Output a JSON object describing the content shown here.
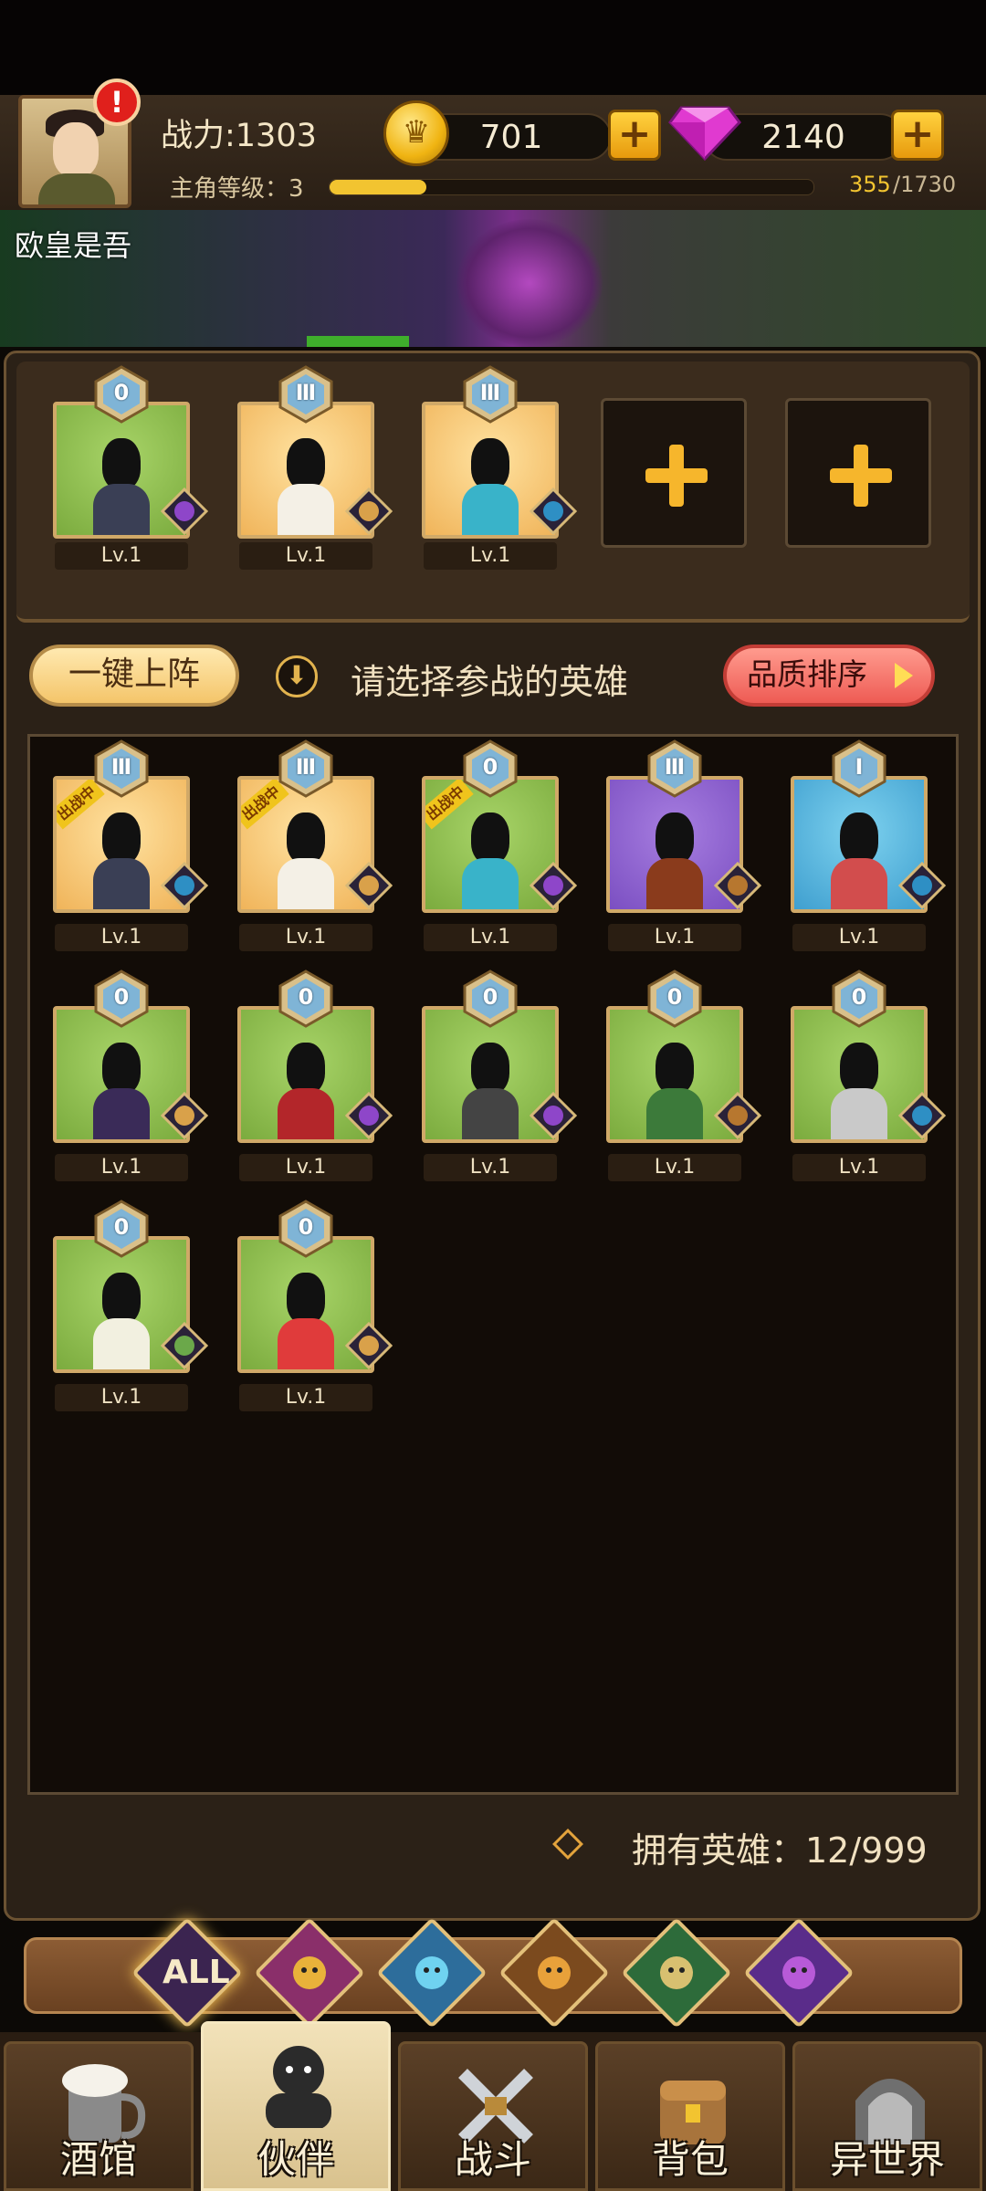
{
  "player": {
    "name": "欧皇是吾",
    "power_label": "战力:1303",
    "level_label": "主角等级：3",
    "xp_current": "355",
    "xp_max": "/1730",
    "xp_fraction": 0.2,
    "alert_icon": "exclamation-icon"
  },
  "resources": {
    "gold": "701",
    "gems": "2140"
  },
  "team": {
    "slots": [
      {
        "rank": "0",
        "level": "Lv.1",
        "card_color": "green",
        "faction": "demon"
      },
      {
        "rank": "Ⅲ",
        "level": "Lv.1",
        "card_color": "gold",
        "faction": "human"
      },
      {
        "rank": "Ⅲ",
        "level": "Lv.1",
        "card_color": "gold",
        "faction": "merfolk"
      }
    ],
    "empty_slot_icon": "plus-icon"
  },
  "actions": {
    "auto_deploy": "一键上阵",
    "hint": "请选择参战的英雄",
    "sort": "品质排序"
  },
  "heroes": [
    {
      "rank": "Ⅲ",
      "level": "Lv.1",
      "deployed": "出战中",
      "card_color": "gold"
    },
    {
      "rank": "Ⅲ",
      "level": "Lv.1",
      "deployed": "出战中",
      "card_color": "gold"
    },
    {
      "rank": "0",
      "level": "Lv.1",
      "deployed": "出战中",
      "card_color": "green"
    },
    {
      "rank": "Ⅲ",
      "level": "Lv.1",
      "deployed": "",
      "card_color": "purple"
    },
    {
      "rank": "Ⅰ",
      "level": "Lv.1",
      "deployed": "",
      "card_color": "blue"
    },
    {
      "rank": "0",
      "level": "Lv.1",
      "deployed": "",
      "card_color": "green"
    },
    {
      "rank": "0",
      "level": "Lv.1",
      "deployed": "",
      "card_color": "green"
    },
    {
      "rank": "0",
      "level": "Lv.1",
      "deployed": "",
      "card_color": "green"
    },
    {
      "rank": "0",
      "level": "Lv.1",
      "deployed": "",
      "card_color": "green"
    },
    {
      "rank": "0",
      "level": "Lv.1",
      "deployed": "",
      "card_color": "green"
    },
    {
      "rank": "0",
      "level": "Lv.1",
      "deployed": "",
      "card_color": "green"
    },
    {
      "rank": "0",
      "level": "Lv.1",
      "deployed": "",
      "card_color": "green"
    }
  ],
  "owned": "拥有英雄：12/999",
  "filters": {
    "all": "ALL",
    "icons": [
      "human-faction-icon",
      "merfolk-faction-icon",
      "beast-faction-icon",
      "elf-faction-icon",
      "demon-faction-icon"
    ]
  },
  "nav": [
    {
      "label": "酒馆",
      "icon": "beer-mug-icon"
    },
    {
      "label": "伙伴",
      "icon": "companion-icon"
    },
    {
      "label": "战斗",
      "icon": "crossed-swords-icon"
    },
    {
      "label": "背包",
      "icon": "backpack-icon"
    },
    {
      "label": "异世界",
      "icon": "portal-icon"
    }
  ],
  "colors": {
    "accent_gold": "#f2c430",
    "sort_red": "#ee5b54",
    "panel_brown": "#2b2117"
  }
}
